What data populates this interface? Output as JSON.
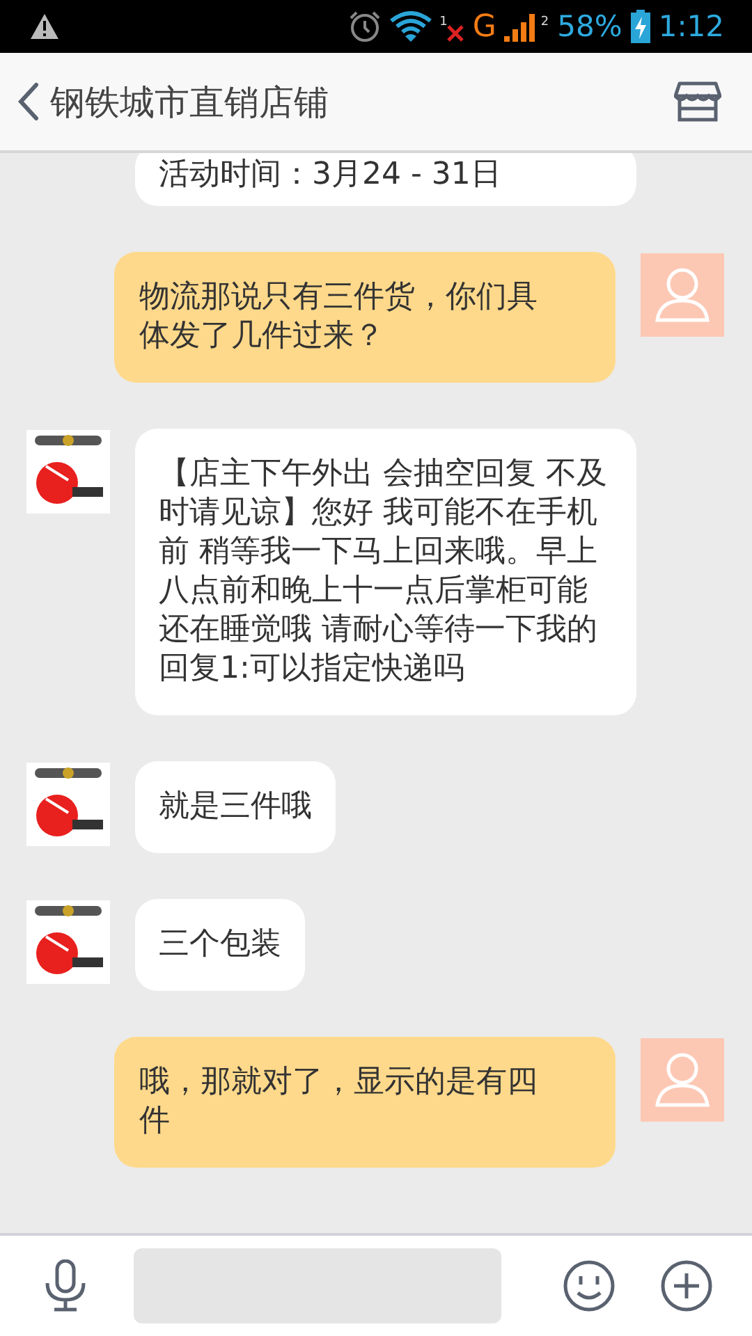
{
  "status_bar": {
    "sim1_label": "1",
    "network_type": "G",
    "sim2_label": "2",
    "battery": "58%",
    "time": "1:12"
  },
  "header": {
    "title": "钢铁城市直销店铺"
  },
  "messages": [
    {
      "kind": "incoming_cut",
      "text": "活动时间：3月24 - 31日"
    },
    {
      "kind": "outgoing",
      "text": "物流那说只有三件货，你们具体发了几件过来？"
    },
    {
      "kind": "incoming",
      "lines": [
        "【店主下午外出 会抽空回复 不及时请见谅】您好 我可能不在手机前 稍等我一下马上回来哦。早上八点前和晚上十一点后掌柜可能还在睡觉哦 请耐心等待一下我的",
        "回复1:可以指定快递吗"
      ]
    },
    {
      "kind": "incoming",
      "text": "就是三件哦"
    },
    {
      "kind": "incoming",
      "text": "三个包装"
    },
    {
      "kind": "outgoing",
      "text": "哦，那就对了，显示的是有四件"
    }
  ]
}
